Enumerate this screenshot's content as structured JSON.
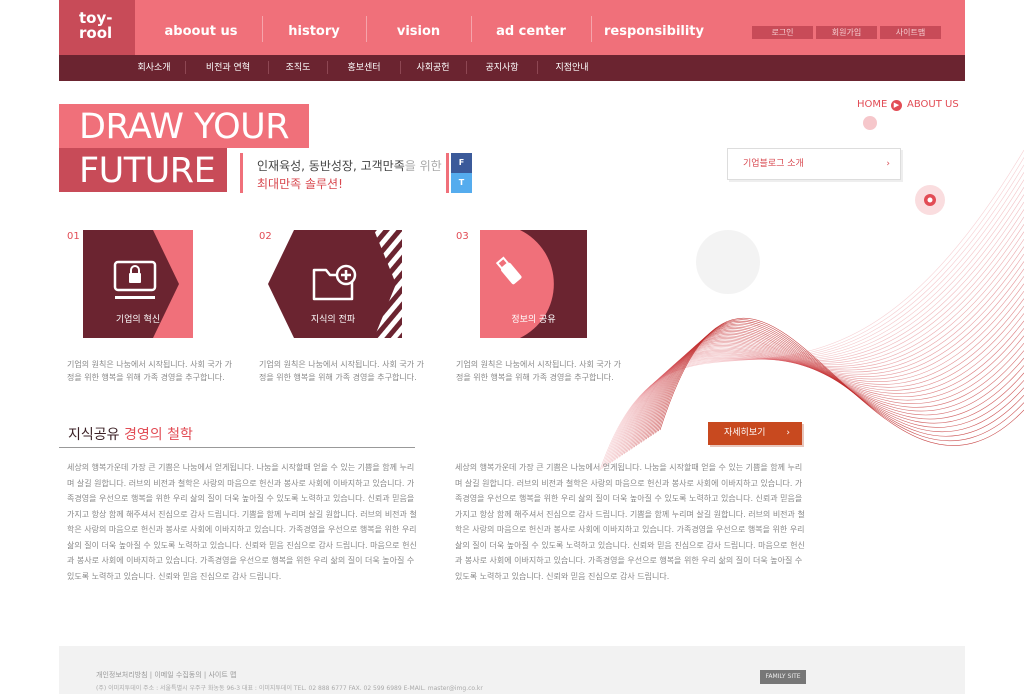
{
  "logo": {
    "line1": "toy-",
    "line2": "rool"
  },
  "nav": [
    {
      "label": "aboout us"
    },
    {
      "label": "history"
    },
    {
      "label": "vision"
    },
    {
      "label": "ad center"
    },
    {
      "label": "responsibility"
    }
  ],
  "utility": [
    {
      "label": "로그인"
    },
    {
      "label": "회원가입"
    },
    {
      "label": "사이트맵"
    }
  ],
  "subnav": [
    {
      "label": "회사소개"
    },
    {
      "label": "비전과 연혁"
    },
    {
      "label": "조직도"
    },
    {
      "label": "홍보센터"
    },
    {
      "label": "사회공헌"
    },
    {
      "label": "공지사항"
    },
    {
      "label": "지점안내"
    }
  ],
  "breadcrumb": {
    "home": "HOME",
    "current": "ABOUT US"
  },
  "hero": {
    "line1": "DRAW YOUR",
    "line2": "FUTURE",
    "sub_dark": "인재육성, 동반성장, 고객만족",
    "sub_light": "을 위한",
    "sub2": "최대만족 솔루션!"
  },
  "social": {
    "facebook": "F",
    "twitter": "T"
  },
  "blog_link": {
    "label": "기업블로그 소개",
    "chevron": "›"
  },
  "features": [
    {
      "num": "01",
      "title": "기업의 혁신",
      "icon": "lock-monitor-icon",
      "text": "기업의 원칙은 나눔에서 시작됩니다. 사회 국가 가정을 위한 행복을 위해 가족 경영을 추구합니다."
    },
    {
      "num": "02",
      "title": "지식의 전파",
      "icon": "folder-add-icon",
      "text": "기업의 원칙은 나눔에서 시작됩니다. 사회 국가 가정을 위한 행복을 위해 가족 경영을 추구합니다."
    },
    {
      "num": "03",
      "title": "정보의 공유",
      "icon": "usb-icon",
      "text": "기업의 원칙은 나눔에서 시작됩니다. 사회 국가 가정을 위한 행복을 위해 가족 경영을 추구합니다."
    }
  ],
  "philosophy": {
    "title_dark": "지식공유",
    "title_accent": "경영의 철학",
    "paragraph": "세상의 행복가운데 가장 큰 기쁨은 나눔에서 얻게됩니다. 나눔을 시작할때 얻을 수 있는 기쁨을 함께 누리며 살길 원합니다. 러브의 비전과 철학은 사랑의 마음으로 헌신과 봉사로 사회에 이바지하고 있습니다. 가족경영을 우선으로 행복을 위한 우리 삶의 질이 더욱 높아질 수 있도록 노력하고 있습니다. 신뢰과 믿음을 가지고 항상 함께 해주셔서 진심으로 감사 드립니다. 기쁨을 함께 누리며 살길 원합니다. 러브의 비전과 철학은 사랑의 마음으로 헌신과 봉사로 사회에 이바지하고 있습니다. 가족경영을 우선으로 행복을 위한 우리 삶의 질이 더욱 높아질 수 있도록 노력하고 있습니다. 신뢰와 믿음 진심으로 감사 드립니다. 마음으로 헌신과 봉사로 사회에 이바지하고 있습니다. 가족경영을 우선으로 행복을 위한 우리 삶의 질이 더욱 높아질 수 있도록 노력하고 있습니다. 신뢰와 믿음 진심으로 감사 드립니다."
  },
  "more_button": {
    "label": "자세히보기",
    "chevron": "›"
  },
  "footer": {
    "links": "개인정보처리방침  |  이메일 수집동의  |  사이트 맵",
    "address": "(주) 이미지투데이   주소 : 서울특별시 우주구 화농동 96-3   대표 : 이미지투데이   TEL. 02 888 6777   FAX. 02 599 6989   E-MAIL. master@img.co.kr",
    "family_site": "FAMILY SITE"
  },
  "colors": {
    "accent": "#f0707a",
    "accent_dark": "#c84b58",
    "maroon": "#6b2430",
    "orange": "#c8491f"
  }
}
